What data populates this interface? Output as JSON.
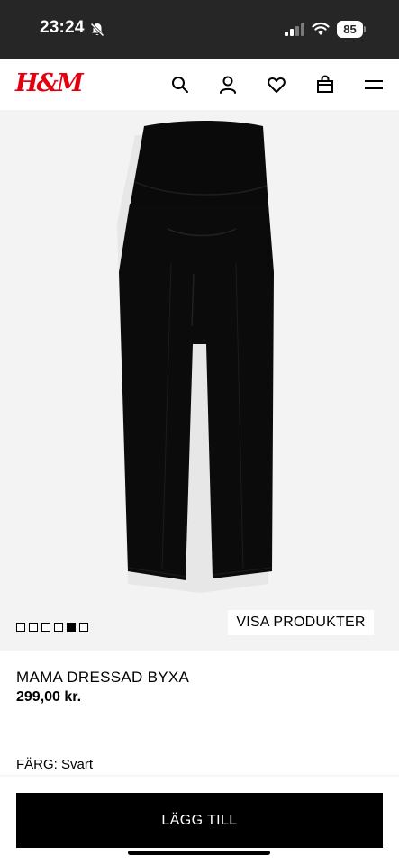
{
  "status_bar": {
    "time": "23:24",
    "battery": "85",
    "icons": [
      "bell-slash-icon",
      "signal-icon",
      "wifi-icon",
      "battery-icon"
    ]
  },
  "header": {
    "logo": "H&M",
    "icons": [
      "search-icon",
      "account-icon",
      "heart-icon",
      "bag-icon",
      "menu-icon"
    ],
    "brand_color": "#e50010"
  },
  "gallery": {
    "image_count": 6,
    "active_index": 4,
    "visa_label": "VISA PRODUKTER"
  },
  "product": {
    "name": "MAMA DRESSAD BYXA",
    "price": "299,00 kr.",
    "color_label": "FÄRG: Svart"
  },
  "cta": {
    "add_label": "LÄGG TILL"
  }
}
